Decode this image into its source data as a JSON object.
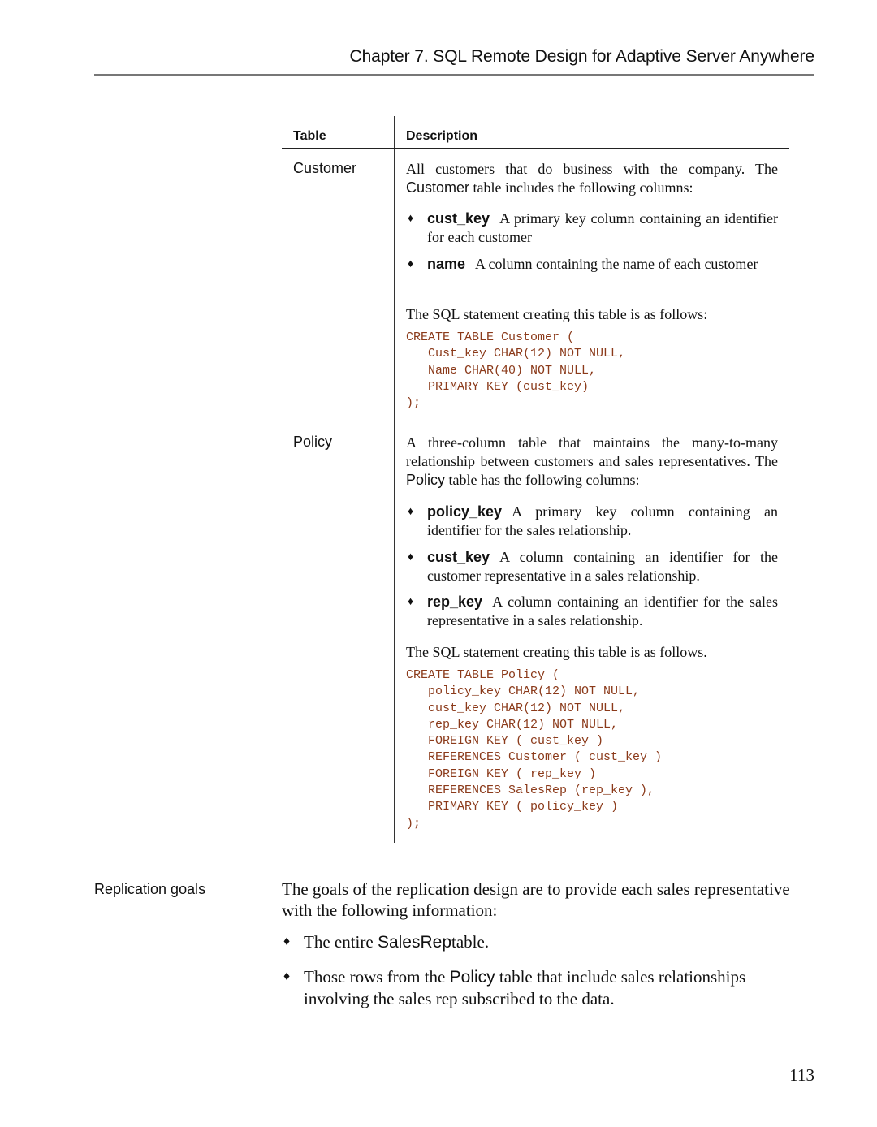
{
  "header": {
    "running_title": "Chapter 7.  SQL Remote Design for Adaptive Server Anywhere"
  },
  "table": {
    "headers": {
      "table": "Table",
      "description": "Description"
    },
    "rows": [
      {
        "name": "Customer",
        "intro_pre": "All customers that do business with the company.  The ",
        "intro_name": "Customer",
        "intro_post": " table includes the following columns:",
        "columns": [
          {
            "key": "cust_key",
            "text": "A primary key column containing an identifier for each customer"
          },
          {
            "key": "name",
            "text": "A column containing the name of each customer"
          }
        ],
        "sql_intro": "The SQL statement creating this table is as follows:",
        "sql": [
          "CREATE TABLE Customer (",
          "   Cust_key CHAR(12) NOT NULL,",
          "   Name CHAR(40) NOT NULL,",
          "   PRIMARY KEY (cust_key)",
          ");"
        ]
      },
      {
        "name": "Policy",
        "intro_pre": "A three-column table that maintains the many-to-many relationship between customers and sales representatives. The ",
        "intro_name": "Policy",
        "intro_post": " table has the following columns:",
        "columns": [
          {
            "key": "policy_key",
            "text": "A primary key column containing an identifier for the sales relationship."
          },
          {
            "key": "cust_key",
            "text": "A column containing an identifier for the customer representative in a sales relationship."
          },
          {
            "key": "rep_key",
            "text": "A column containing an identifier for the sales representative in a sales relationship."
          }
        ],
        "sql_intro": "The SQL statement creating this table is as follows.",
        "sql": [
          "CREATE TABLE Policy (",
          "   policy_key CHAR(12) NOT NULL,",
          "   cust_key CHAR(12) NOT NULL,",
          "   rep_key CHAR(12) NOT NULL,",
          "   FOREIGN KEY ( cust_key )",
          "   REFERENCES Customer ( cust_key )",
          "   FOREIGN KEY ( rep_key )",
          "   REFERENCES SalesRep (rep_key ),",
          "   PRIMARY KEY ( policy_key )",
          ");"
        ]
      }
    ]
  },
  "replication_goals": {
    "side_label": "Replication goals",
    "intro": "The goals of the replication design are to provide each sales representative with the following information:",
    "bullets": [
      {
        "pre": "The entire ",
        "name": "SalesRep",
        "post": "table."
      },
      {
        "pre": "Those rows from the ",
        "name": "Policy",
        "post": " table that include sales relationships involving the sales rep subscribed to the data."
      }
    ]
  },
  "bullet_glyph": "♦",
  "code_color": "#8b3a1a",
  "page_number": "113"
}
